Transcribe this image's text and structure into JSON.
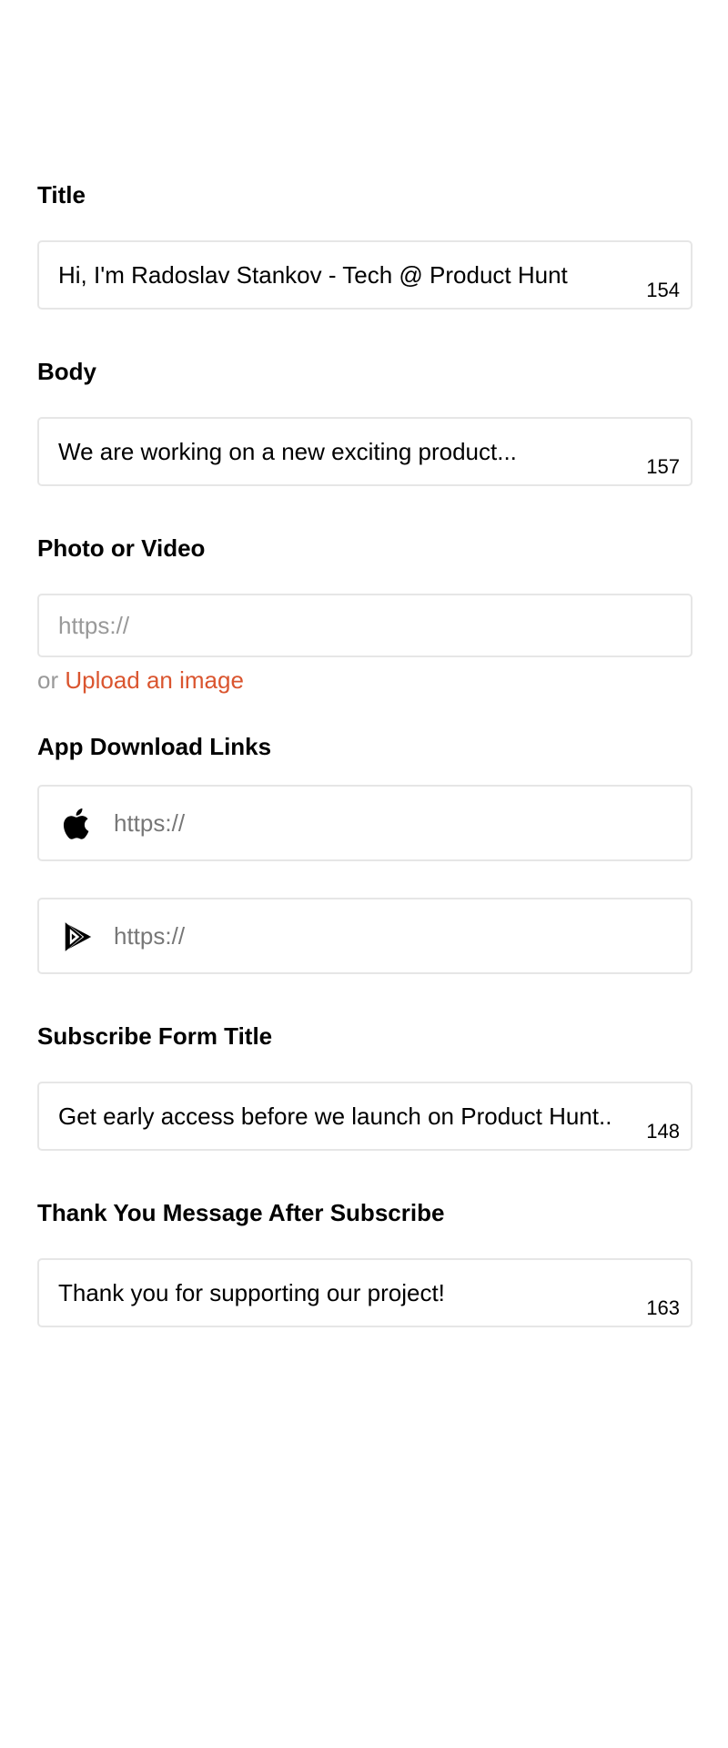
{
  "form": {
    "title": {
      "label": "Title",
      "value": "Hi, I'm Radoslav Stankov - Tech @ Product Hunt",
      "counter": "154"
    },
    "body": {
      "label": "Body",
      "value": "We are working on a new exciting product...",
      "counter": "157"
    },
    "media": {
      "label": "Photo or Video",
      "placeholder": "https://",
      "or_text": "or",
      "upload_link": "Upload an image"
    },
    "app_links": {
      "label": "App Download Links",
      "apple": {
        "icon": "apple-icon",
        "placeholder": "https://"
      },
      "google_play": {
        "icon": "google-play-icon",
        "placeholder": "https://"
      }
    },
    "subscribe_title": {
      "label": "Subscribe Form Title",
      "value": "Get early access before we launch on Product Hunt..",
      "counter": "148"
    },
    "thank_you": {
      "label": "Thank You Message After Subscribe",
      "value": "Thank you for supporting our project!",
      "counter": "163"
    }
  },
  "colors": {
    "accent": "#da552f",
    "border": "#e6e6e6",
    "placeholder": "#999999"
  }
}
